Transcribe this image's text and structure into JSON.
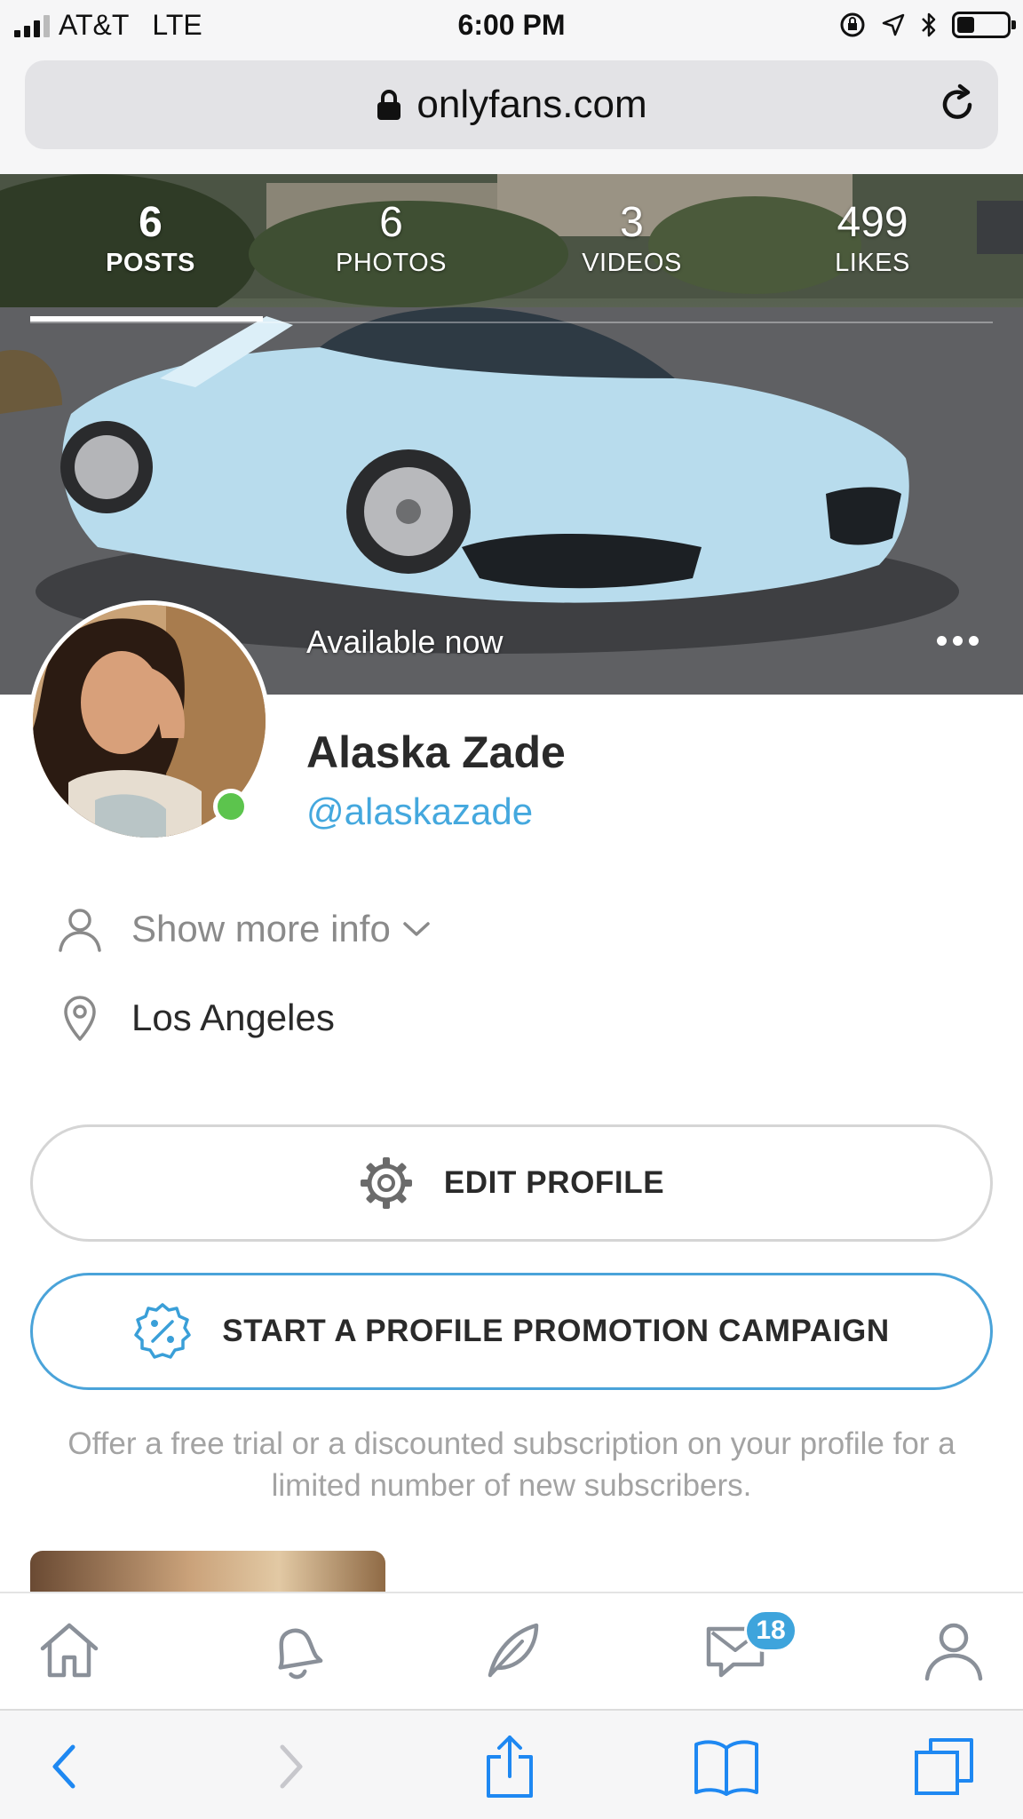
{
  "status_bar": {
    "carrier": "AT&T",
    "network": "LTE",
    "time": "6:00 PM",
    "signal_bars": 4,
    "signal_strength": 3,
    "battery_level": 0.35
  },
  "browser": {
    "url": "onlyfans.com",
    "lock_icon": "lock-icon",
    "reload_icon": "reload-icon"
  },
  "profile_stats": [
    {
      "value": "6",
      "label": "POSTS",
      "active": true
    },
    {
      "value": "6",
      "label": "PHOTOS",
      "active": false
    },
    {
      "value": "3",
      "label": "VIDEOS",
      "active": false
    },
    {
      "value": "499",
      "label": "LIKES",
      "active": false
    }
  ],
  "profile": {
    "availability": "Available now",
    "name": "Alaska Zade",
    "handle": "@alaskazade",
    "online": true
  },
  "info": {
    "show_more": "Show more info",
    "location": "Los Angeles"
  },
  "actions": {
    "edit_profile": "EDIT PROFILE",
    "promotion": "START A PROFILE PROMOTION CAMPAIGN",
    "promotion_note": "Offer a free trial or a discounted subscription on your profile for a limited number of new subscribers."
  },
  "app_nav": {
    "items": [
      "home-icon",
      "bell-icon",
      "feather-icon",
      "messages-icon",
      "profile-icon"
    ],
    "messages_badge": "18"
  },
  "safari_toolbar": {
    "items": [
      "back-icon",
      "forward-icon",
      "share-icon",
      "bookmarks-icon",
      "tabs-icon"
    ]
  },
  "colors": {
    "accent_blue": "#44a8de",
    "online_green": "#5cc44d",
    "badge_blue": "#3ea4dc",
    "promo_border": "#4aa3d9"
  }
}
